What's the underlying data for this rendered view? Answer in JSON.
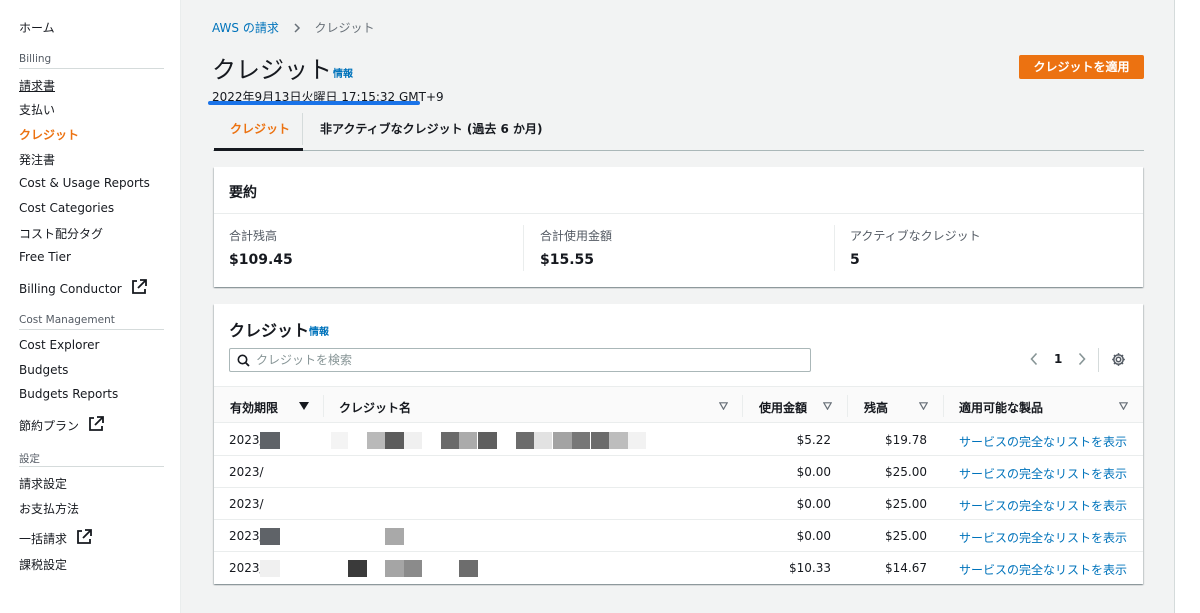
{
  "sidebar": {
    "home": "ホーム",
    "section_billing": "Billing",
    "items_billing": [
      "請求書",
      "支払い",
      "クレジット",
      "発注書",
      "Cost & Usage Reports",
      "Cost Categories",
      "コスト配分タグ",
      "Free Tier",
      "Billing Conductor"
    ],
    "section_cost": "Cost Management",
    "items_cost": [
      "Cost Explorer",
      "Budgets",
      "Budgets Reports",
      "節約プラン"
    ],
    "section_settings": "設定",
    "items_settings": [
      "請求設定",
      "お支払方法",
      "一括請求",
      "課税設定"
    ]
  },
  "breadcrumb": {
    "parent": "AWS の請求",
    "current": "クレジット"
  },
  "page": {
    "title": "クレジット",
    "info": "情報",
    "timestamp": "2022年9月13日火曜日 17:15:32 GMT+9",
    "apply_button": "クレジットを適用"
  },
  "tabs": [
    "クレジット",
    "非アクティブなクレジット (過去 6 か月)"
  ],
  "summary": {
    "title": "要約",
    "metrics": [
      {
        "label": "合計残高",
        "value": "$109.45"
      },
      {
        "label": "合計使用金額",
        "value": "$15.55"
      },
      {
        "label": "アクティブなクレジット",
        "value": "5"
      }
    ]
  },
  "credits": {
    "title": "クレジット",
    "info": "情報",
    "search_placeholder": "クレジットを検索",
    "page": "1",
    "columns": [
      "有効期限",
      "クレジット名",
      "使用金額",
      "残高",
      "適用可能な製品"
    ],
    "rows": [
      {
        "expiry": "2023/",
        "used": "$5.22",
        "balance": "$19.78",
        "products": "サービスの完全なリストを表示"
      },
      {
        "expiry": "2023/",
        "used": "$0.00",
        "balance": "$25.00",
        "products": "サービスの完全なリストを表示"
      },
      {
        "expiry": "2023/",
        "used": "$0.00",
        "balance": "$25.00",
        "products": "サービスの完全なリストを表示"
      },
      {
        "expiry": "2023/",
        "used": "$0.00",
        "balance": "$25.00",
        "products": "サービスの完全なリストを表示"
      },
      {
        "expiry": "2023/",
        "used": "$10.33",
        "balance": "$14.67",
        "products": "サービスの完全なリストを表示"
      }
    ]
  },
  "colors": {
    "accent": "#ec7211",
    "link": "#0073bb",
    "underline_annotation": "#1a73e8"
  },
  "icons": [
    "external-link-icon",
    "chevron-right-icon",
    "search-icon",
    "chevron-left-icon",
    "settings-gear-icon",
    "sort-desc-icon",
    "sort-filter-icon"
  ]
}
